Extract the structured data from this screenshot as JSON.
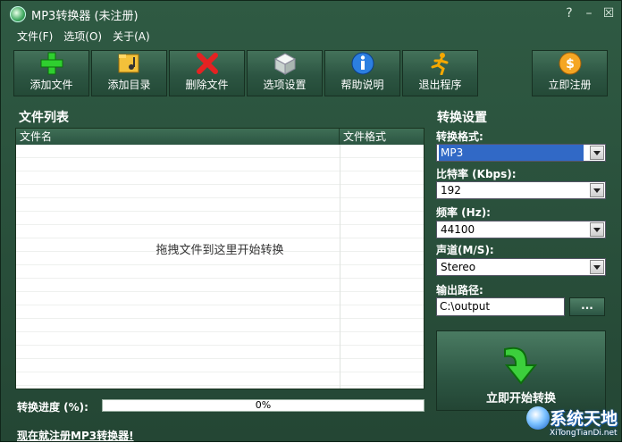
{
  "window": {
    "title": "MP3转换器 (未注册)"
  },
  "menu": [
    "文件(F)",
    "选项(O)",
    "关于(A)"
  ],
  "toolbar": [
    {
      "label": "添加文件",
      "icon": "plus-icon"
    },
    {
      "label": "添加目录",
      "icon": "folder-music-icon"
    },
    {
      "label": "删除文件",
      "icon": "delete-x-icon"
    },
    {
      "label": "选项设置",
      "icon": "cube-icon"
    },
    {
      "label": "帮助说明",
      "icon": "info-icon"
    },
    {
      "label": "退出程序",
      "icon": "running-man-icon"
    }
  ],
  "register": {
    "label": "立即注册",
    "icon": "coin-dollar-icon"
  },
  "file_list": {
    "title": "文件列表",
    "columns": [
      "文件名",
      "文件格式"
    ],
    "empty_hint": "拖拽文件到这里开始转换"
  },
  "progress": {
    "label": "转换进度 (%):",
    "value": 0,
    "text": "0%"
  },
  "promo": "现在就注册MP3转换器!",
  "settings": {
    "title": "转换设置",
    "format": {
      "label": "转换格式:",
      "value": "MP3"
    },
    "bitrate": {
      "label": "比特率 (Kbps):",
      "value": "192"
    },
    "frequency": {
      "label": "频率 (Hz):",
      "value": "44100"
    },
    "channel": {
      "label": "声道(M/S):",
      "value": "Stereo"
    },
    "output": {
      "label": "输出路径:",
      "value": "C:\\output",
      "browse": "..."
    },
    "start_label": "立即开始转换"
  },
  "watermark": {
    "text": "系统天地",
    "url": "XiTongTianDi.net"
  }
}
